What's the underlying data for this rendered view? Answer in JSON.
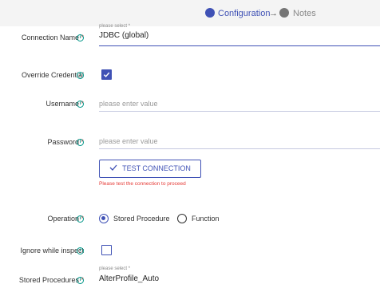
{
  "stepper": {
    "steps": [
      {
        "label": "Configuration",
        "state": "active"
      },
      {
        "label": "Notes",
        "state": "inactive"
      }
    ],
    "arrow": "→"
  },
  "form": {
    "connection_name": {
      "label": "Connection Name",
      "required": "*",
      "hint": "please select *",
      "value": "JDBC (global)"
    },
    "override_credential": {
      "label": "Override Credential",
      "checked": true
    },
    "username": {
      "label": "Username",
      "required": "*",
      "placeholder": "please enter value"
    },
    "password": {
      "label": "Password",
      "required": "*",
      "placeholder": "please enter value"
    },
    "test_connection": {
      "label": "TEST CONNECTION",
      "warning": "Please test the connection to proceed"
    },
    "operation": {
      "label": "Operation",
      "required": "*",
      "options": [
        "Stored Procedure",
        "Function"
      ],
      "selected": "Stored Procedure"
    },
    "ignore_while_inspect": {
      "label": "Ignore while inspect",
      "checked": false
    },
    "stored_procedures": {
      "label": "Stored Procedures",
      "required": "*",
      "hint": "please select *",
      "value": "AlterProfile_Auto"
    }
  },
  "icons": {
    "info": "info-icon",
    "check": "check-icon"
  },
  "colors": {
    "accent": "#3f51b5",
    "required": "#e53935",
    "info": "#009688"
  }
}
